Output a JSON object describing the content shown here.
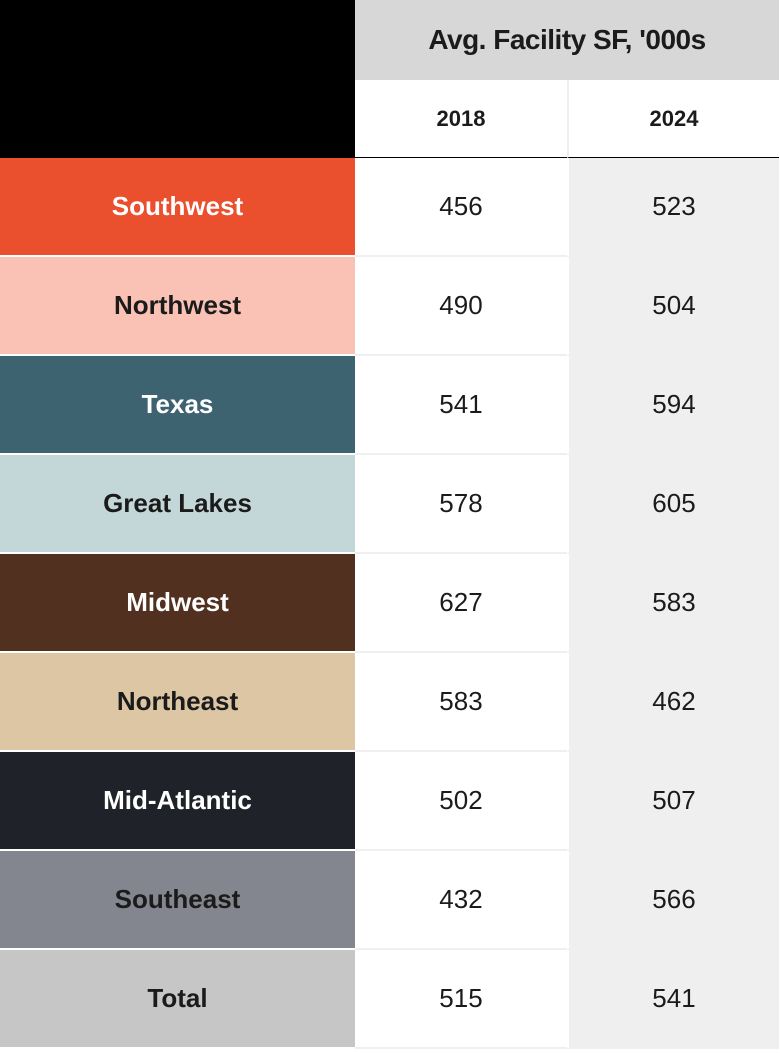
{
  "chart_data": {
    "type": "table",
    "title": "Avg. Facility SF, '000s",
    "columns": [
      "2018",
      "2024"
    ],
    "rows": [
      {
        "label": "Southwest",
        "color": "#EA4F2E",
        "text": "light",
        "values": [
          456,
          523
        ]
      },
      {
        "label": "Northwest",
        "color": "#F9C2B4",
        "text": "dark",
        "values": [
          490,
          504
        ]
      },
      {
        "label": "Texas",
        "color": "#3E6370",
        "text": "light",
        "values": [
          541,
          594
        ]
      },
      {
        "label": "Great Lakes",
        "color": "#C3D7D9",
        "text": "dark",
        "values": [
          578,
          605
        ]
      },
      {
        "label": "Midwest",
        "color": "#52301F",
        "text": "light",
        "values": [
          627,
          583
        ]
      },
      {
        "label": "Northeast",
        "color": "#DDC6A4",
        "text": "dark",
        "values": [
          583,
          462
        ]
      },
      {
        "label": "Mid-Atlantic",
        "color": "#20222A",
        "text": "light",
        "values": [
          502,
          507
        ]
      },
      {
        "label": "Southeast",
        "color": "#84868F",
        "text": "dark",
        "values": [
          432,
          566
        ]
      },
      {
        "label": "Total",
        "color": "#C6C6C6",
        "text": "dark",
        "values": [
          515,
          541
        ]
      }
    ]
  }
}
